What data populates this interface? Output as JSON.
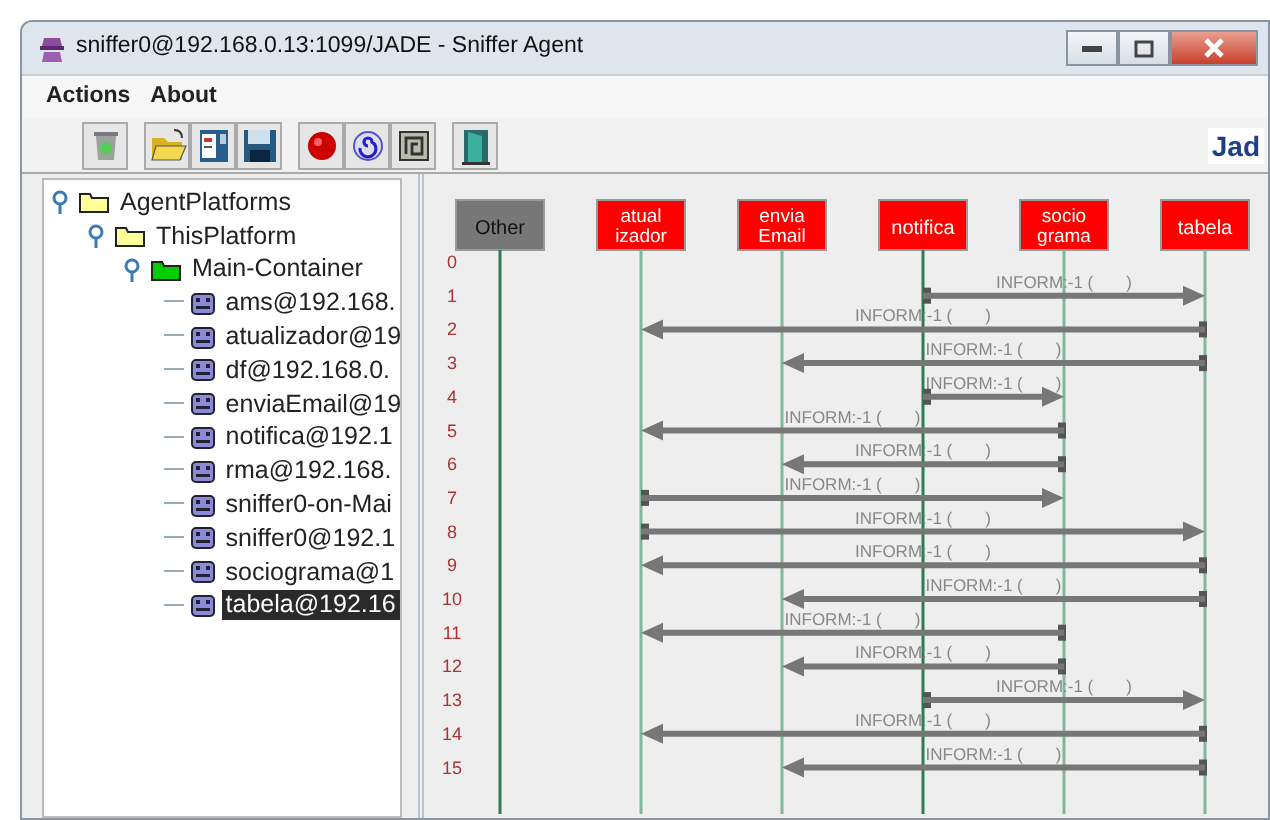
{
  "window": {
    "title": "sniffer0@192.168.0.13:1099/JADE - Sniffer Agent"
  },
  "menu": [
    {
      "label": "Actions"
    },
    {
      "label": "About"
    }
  ],
  "logo": {
    "text": "Jad"
  },
  "tree": [
    {
      "label": "AgentPlatforms",
      "kind": "platform",
      "expanded": true,
      "children": [
        {
          "label": "ThisPlatform",
          "kind": "platform",
          "expanded": true,
          "children": [
            {
              "label": "Main-Container",
              "kind": "container",
              "expanded": true,
              "children": [
                {
                  "label": "ams@192.168.",
                  "kind": "agent",
                  "selected": false
                },
                {
                  "label": "atualizador@19",
                  "kind": "agent",
                  "selected": false
                },
                {
                  "label": "df@192.168.0.",
                  "kind": "agent",
                  "selected": false
                },
                {
                  "label": "enviaEmail@19",
                  "kind": "agent",
                  "selected": false
                },
                {
                  "label": "notifica@192.1",
                  "kind": "agent",
                  "selected": false
                },
                {
                  "label": "rma@192.168.",
                  "kind": "agent",
                  "selected": false
                },
                {
                  "label": "sniffer0-on-Mai",
                  "kind": "agent",
                  "selected": false
                },
                {
                  "label": "sniffer0@192.1",
                  "kind": "agent",
                  "selected": false
                },
                {
                  "label": "sociograma@1",
                  "kind": "agent",
                  "selected": false
                },
                {
                  "label": "tabela@192.16",
                  "kind": "agent",
                  "selected": true
                }
              ]
            }
          ]
        }
      ]
    }
  ],
  "agents": [
    {
      "lines": [
        "Other"
      ],
      "color": "#777777"
    },
    {
      "lines": [
        "atual",
        "izador"
      ],
      "color": "#ff0000"
    },
    {
      "lines": [
        "envia",
        "Email"
      ],
      "color": "#ff0000"
    },
    {
      "lines": [
        "notifica"
      ],
      "color": "#ff0000"
    },
    {
      "lines": [
        "socio",
        "grama"
      ],
      "color": "#ff0000"
    },
    {
      "lines": [
        "tabela"
      ],
      "color": "#ff0000"
    }
  ],
  "rows": [
    {
      "number": "0"
    },
    {
      "number": "1",
      "message": {
        "label": "INFORM:-1 (       )",
        "lanes": [
          {
            "kind": "idle"
          },
          {
            "kind": "idle"
          },
          {
            "kind": "idle"
          },
          {
            "kind": "sender"
          },
          {
            "kind": "idle"
          },
          {
            "kind": "receiver"
          }
        ]
      }
    },
    {
      "number": "2",
      "message": {
        "label": "INFORM:-1 (       )",
        "lanes": [
          {
            "kind": "idle"
          },
          {
            "kind": "receiver"
          },
          {
            "kind": "idle"
          },
          {
            "kind": "idle"
          },
          {
            "kind": "idle"
          },
          {
            "kind": "sender"
          }
        ]
      }
    },
    {
      "number": "3",
      "message": {
        "label": "INFORM:-1 (       )",
        "lanes": [
          {
            "kind": "idle"
          },
          {
            "kind": "idle"
          },
          {
            "kind": "receiver"
          },
          {
            "kind": "idle"
          },
          {
            "kind": "idle"
          },
          {
            "kind": "sender"
          }
        ]
      }
    },
    {
      "number": "4",
      "message": {
        "label": "INFORM:-1 (       )",
        "lanes": [
          {
            "kind": "idle"
          },
          {
            "kind": "idle"
          },
          {
            "kind": "idle"
          },
          {
            "kind": "sender"
          },
          {
            "kind": "receiver"
          },
          {
            "kind": "idle"
          }
        ]
      }
    },
    {
      "number": "5",
      "message": {
        "label": "INFORM:-1 (       )",
        "lanes": [
          {
            "kind": "idle"
          },
          {
            "kind": "receiver"
          },
          {
            "kind": "idle"
          },
          {
            "kind": "idle"
          },
          {
            "kind": "sender"
          },
          {
            "kind": "idle"
          }
        ]
      }
    },
    {
      "number": "6",
      "message": {
        "label": "INFORM:-1 (       )",
        "lanes": [
          {
            "kind": "idle"
          },
          {
            "kind": "idle"
          },
          {
            "kind": "receiver"
          },
          {
            "kind": "idle"
          },
          {
            "kind": "sender"
          },
          {
            "kind": "idle"
          }
        ]
      }
    },
    {
      "number": "7",
      "message": {
        "label": "INFORM:-1 (       )",
        "lanes": [
          {
            "kind": "idle"
          },
          {
            "kind": "sender"
          },
          {
            "kind": "idle"
          },
          {
            "kind": "idle"
          },
          {
            "kind": "receiver"
          },
          {
            "kind": "idle"
          }
        ]
      }
    },
    {
      "number": "8",
      "message": {
        "label": "INFORM:-1 (       )",
        "lanes": [
          {
            "kind": "idle"
          },
          {
            "kind": "sender"
          },
          {
            "kind": "idle"
          },
          {
            "kind": "idle"
          },
          {
            "kind": "idle"
          },
          {
            "kind": "receiver"
          }
        ]
      }
    },
    {
      "number": "9",
      "message": {
        "label": "INFORM:-1 (       )",
        "lanes": [
          {
            "kind": "idle"
          },
          {
            "kind": "receiver"
          },
          {
            "kind": "idle"
          },
          {
            "kind": "idle"
          },
          {
            "kind": "idle"
          },
          {
            "kind": "sender"
          }
        ]
      }
    },
    {
      "number": "10",
      "message": {
        "label": "INFORM:-1 (       )",
        "lanes": [
          {
            "kind": "idle"
          },
          {
            "kind": "idle"
          },
          {
            "kind": "receiver"
          },
          {
            "kind": "idle"
          },
          {
            "kind": "idle"
          },
          {
            "kind": "sender"
          }
        ]
      }
    },
    {
      "number": "11",
      "message": {
        "label": "INFORM:-1 (       )",
        "lanes": [
          {
            "kind": "idle"
          },
          {
            "kind": "receiver"
          },
          {
            "kind": "idle"
          },
          {
            "kind": "idle"
          },
          {
            "kind": "sender"
          },
          {
            "kind": "idle"
          }
        ]
      }
    },
    {
      "number": "12",
      "message": {
        "label": "INFORM:-1 (       )",
        "lanes": [
          {
            "kind": "idle"
          },
          {
            "kind": "idle"
          },
          {
            "kind": "receiver"
          },
          {
            "kind": "idle"
          },
          {
            "kind": "sender"
          },
          {
            "kind": "idle"
          }
        ]
      }
    },
    {
      "number": "13",
      "message": {
        "label": "INFORM:-1 (       )",
        "lanes": [
          {
            "kind": "idle"
          },
          {
            "kind": "idle"
          },
          {
            "kind": "idle"
          },
          {
            "kind": "sender"
          },
          {
            "kind": "idle"
          },
          {
            "kind": "receiver"
          }
        ]
      }
    },
    {
      "number": "14",
      "message": {
        "label": "INFORM:-1 (       )",
        "lanes": [
          {
            "kind": "idle"
          },
          {
            "kind": "receiver"
          },
          {
            "kind": "idle"
          },
          {
            "kind": "idle"
          },
          {
            "kind": "idle"
          },
          {
            "kind": "sender"
          }
        ]
      }
    },
    {
      "number": "15",
      "message": {
        "label": "INFORM:-1 (       )",
        "lanes": [
          {
            "kind": "idle"
          },
          {
            "kind": "idle"
          },
          {
            "kind": "receiver"
          },
          {
            "kind": "idle"
          },
          {
            "kind": "idle"
          },
          {
            "kind": "sender"
          }
        ]
      }
    }
  ]
}
